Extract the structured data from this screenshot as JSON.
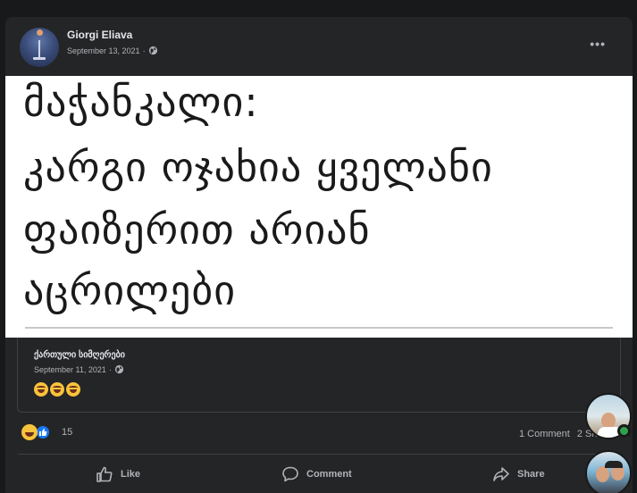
{
  "post": {
    "author": "Giorgi Eliava",
    "date": "September 13, 2021",
    "separator": " · ",
    "more_label": "•••",
    "image_lines": [
      "მაჭანკალი:",
      " კარგი ოჯახია ყველანი",
      "ფაიზერით არიან",
      "აცრილები"
    ]
  },
  "shared": {
    "name": "ქართული სიმღერები",
    "date": "September 11, 2021",
    "separator": " · "
  },
  "reactions": {
    "count": "15",
    "types": [
      "haha-icon",
      "like-icon"
    ]
  },
  "stats": {
    "comments": "1 Comment",
    "shares": "2 Sh"
  },
  "actions": {
    "like": "Like",
    "comment": "Comment",
    "share": "Share"
  },
  "colors": {
    "background": "#18191a",
    "card": "#242526",
    "text_primary": "#e4e6eb",
    "text_secondary": "#b0b3b8",
    "like_blue": "#1877f2",
    "online_green": "#31a24c"
  }
}
